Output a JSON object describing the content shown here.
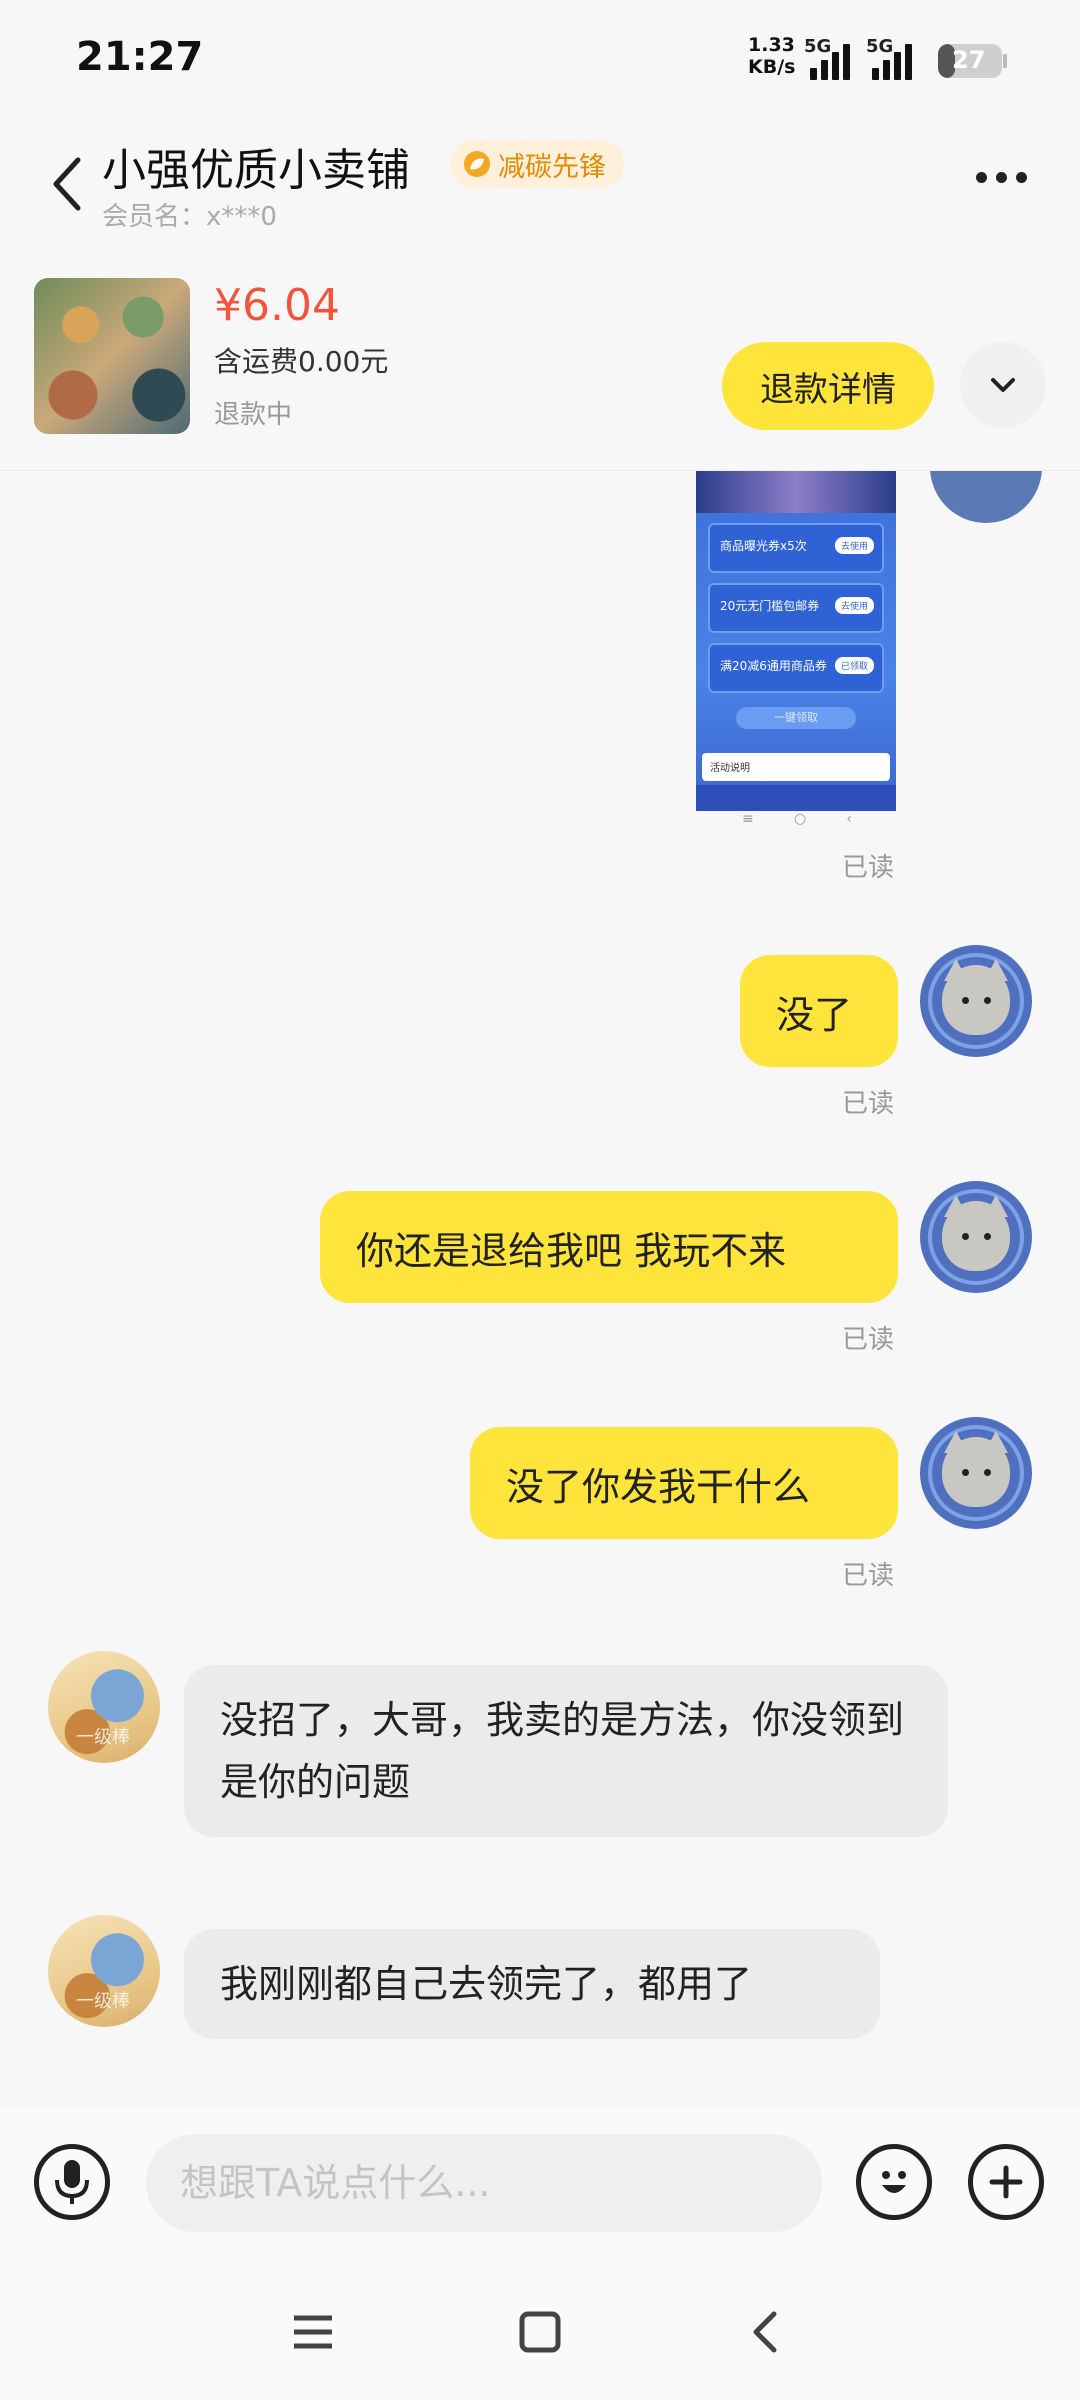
{
  "status_bar": {
    "time": "21:27",
    "net_speed": "1.33",
    "net_unit": "KB/s",
    "signal1": "5G",
    "signal2": "5G",
    "battery": "27",
    "battery_level": 0.27
  },
  "header": {
    "shop_name": "小强优质小卖铺",
    "badge": "减碳先锋",
    "member": "会员名：x***0"
  },
  "product": {
    "price": "¥6.04",
    "shipping": "含运费0.00元",
    "status": "退款中",
    "refund_button": "退款详情"
  },
  "screenshot_preview": {
    "coupons": [
      {
        "name": "商品曝光券x5次",
        "action": "去使用"
      },
      {
        "name": "20元无门槛包邮券",
        "action": "去使用"
      },
      {
        "name": "满20减6通用商品券",
        "action": "已领取"
      }
    ],
    "grab_all": "一键领取",
    "rules": "活动说明"
  },
  "messages": [
    {
      "from": "me",
      "text": "没了",
      "read": "已读"
    },
    {
      "from": "me",
      "text": "你还是退给我吧 我玩不来",
      "read": "已读"
    },
    {
      "from": "me",
      "text": "没了你发我干什么",
      "read": "已读"
    },
    {
      "from": "other",
      "text": "没招了，大哥，我卖的是方法，你没领到是你的问题"
    },
    {
      "from": "other",
      "text": "我刚刚都自己去领完了，都用了"
    }
  ],
  "first_read": "已读",
  "other_avatar_caption": "一级棒",
  "input": {
    "placeholder": "想跟TA说点什么..."
  },
  "colors": {
    "accent_yellow": "#ffe53b",
    "price_red": "#f2553b",
    "badge_orange": "#e48a00"
  }
}
